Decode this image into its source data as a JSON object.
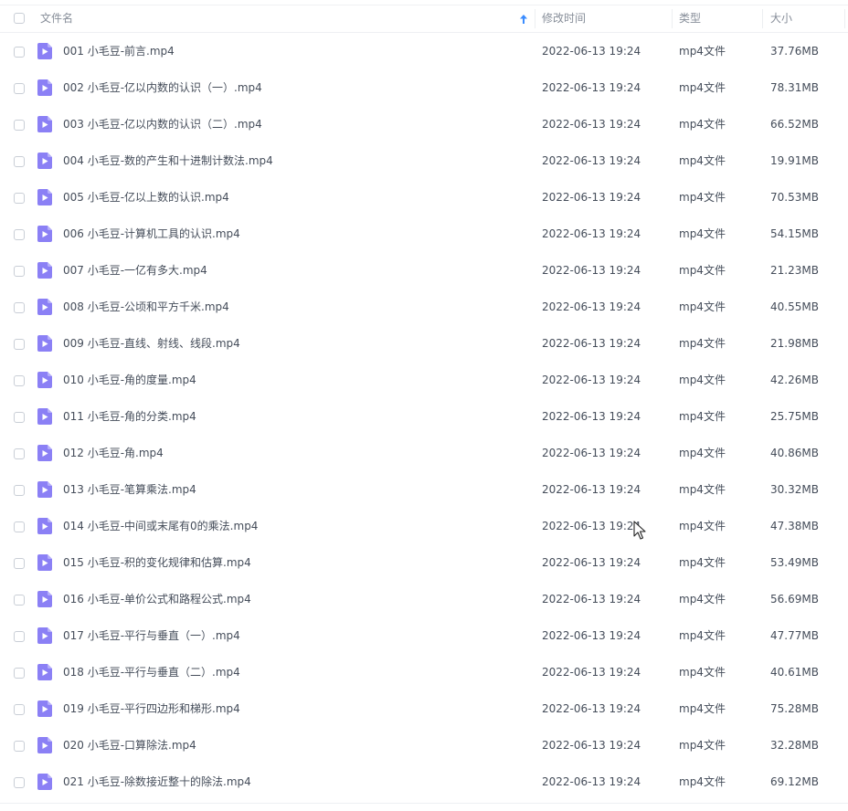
{
  "header": {
    "name": "文件名",
    "modified": "修改时间",
    "type": "类型",
    "size": "大小",
    "sort_icon": "sort-up-arrow-icon"
  },
  "colors": {
    "icon": "#8b80f5",
    "accent": "#3a8cff"
  },
  "file_icon": "video-file-icon",
  "rows": [
    {
      "name": "001 小毛豆-前言.mp4",
      "time": "2022-06-13 19:24",
      "type": "mp4文件",
      "size": "37.76MB"
    },
    {
      "name": "002 小毛豆-亿以内数的认识（一）.mp4",
      "time": "2022-06-13 19:24",
      "type": "mp4文件",
      "size": "78.31MB"
    },
    {
      "name": "003 小毛豆-亿以内数的认识（二）.mp4",
      "time": "2022-06-13 19:24",
      "type": "mp4文件",
      "size": "66.52MB"
    },
    {
      "name": "004 小毛豆-数的产生和十进制计数法.mp4",
      "time": "2022-06-13 19:24",
      "type": "mp4文件",
      "size": "19.91MB"
    },
    {
      "name": "005 小毛豆-亿以上数的认识.mp4",
      "time": "2022-06-13 19:24",
      "type": "mp4文件",
      "size": "70.53MB"
    },
    {
      "name": "006 小毛豆-计算机工具的认识.mp4",
      "time": "2022-06-13 19:24",
      "type": "mp4文件",
      "size": "54.15MB"
    },
    {
      "name": "007 小毛豆-一亿有多大.mp4",
      "time": "2022-06-13 19:24",
      "type": "mp4文件",
      "size": "21.23MB"
    },
    {
      "name": "008 小毛豆-公顷和平方千米.mp4",
      "time": "2022-06-13 19:24",
      "type": "mp4文件",
      "size": "40.55MB"
    },
    {
      "name": "009 小毛豆-直线、射线、线段.mp4",
      "time": "2022-06-13 19:24",
      "type": "mp4文件",
      "size": "21.98MB"
    },
    {
      "name": "010 小毛豆-角的度量.mp4",
      "time": "2022-06-13 19:24",
      "type": "mp4文件",
      "size": "42.26MB"
    },
    {
      "name": "011 小毛豆-角的分类.mp4",
      "time": "2022-06-13 19:24",
      "type": "mp4文件",
      "size": "25.75MB"
    },
    {
      "name": "012 小毛豆-角.mp4",
      "time": "2022-06-13 19:24",
      "type": "mp4文件",
      "size": "40.86MB"
    },
    {
      "name": "013 小毛豆-笔算乘法.mp4",
      "time": "2022-06-13 19:24",
      "type": "mp4文件",
      "size": "30.32MB"
    },
    {
      "name": "014 小毛豆-中间或末尾有0的乘法.mp4",
      "time": "2022-06-13 19:24",
      "type": "mp4文件",
      "size": "47.38MB"
    },
    {
      "name": "015 小毛豆-积的变化规律和估算.mp4",
      "time": "2022-06-13 19:24",
      "type": "mp4文件",
      "size": "53.49MB"
    },
    {
      "name": "016 小毛豆-单价公式和路程公式.mp4",
      "time": "2022-06-13 19:24",
      "type": "mp4文件",
      "size": "56.69MB"
    },
    {
      "name": "017 小毛豆-平行与垂直（一）.mp4",
      "time": "2022-06-13 19:24",
      "type": "mp4文件",
      "size": "47.77MB"
    },
    {
      "name": "018 小毛豆-平行与垂直（二）.mp4",
      "time": "2022-06-13 19:24",
      "type": "mp4文件",
      "size": "40.61MB"
    },
    {
      "name": "019 小毛豆-平行四边形和梯形.mp4",
      "time": "2022-06-13 19:24",
      "type": "mp4文件",
      "size": "75.28MB"
    },
    {
      "name": "020 小毛豆-口算除法.mp4",
      "time": "2022-06-13 19:24",
      "type": "mp4文件",
      "size": "32.28MB"
    },
    {
      "name": "021 小毛豆-除数接近整十的除法.mp4",
      "time": "2022-06-13 19:24",
      "type": "mp4文件",
      "size": "69.12MB"
    }
  ]
}
